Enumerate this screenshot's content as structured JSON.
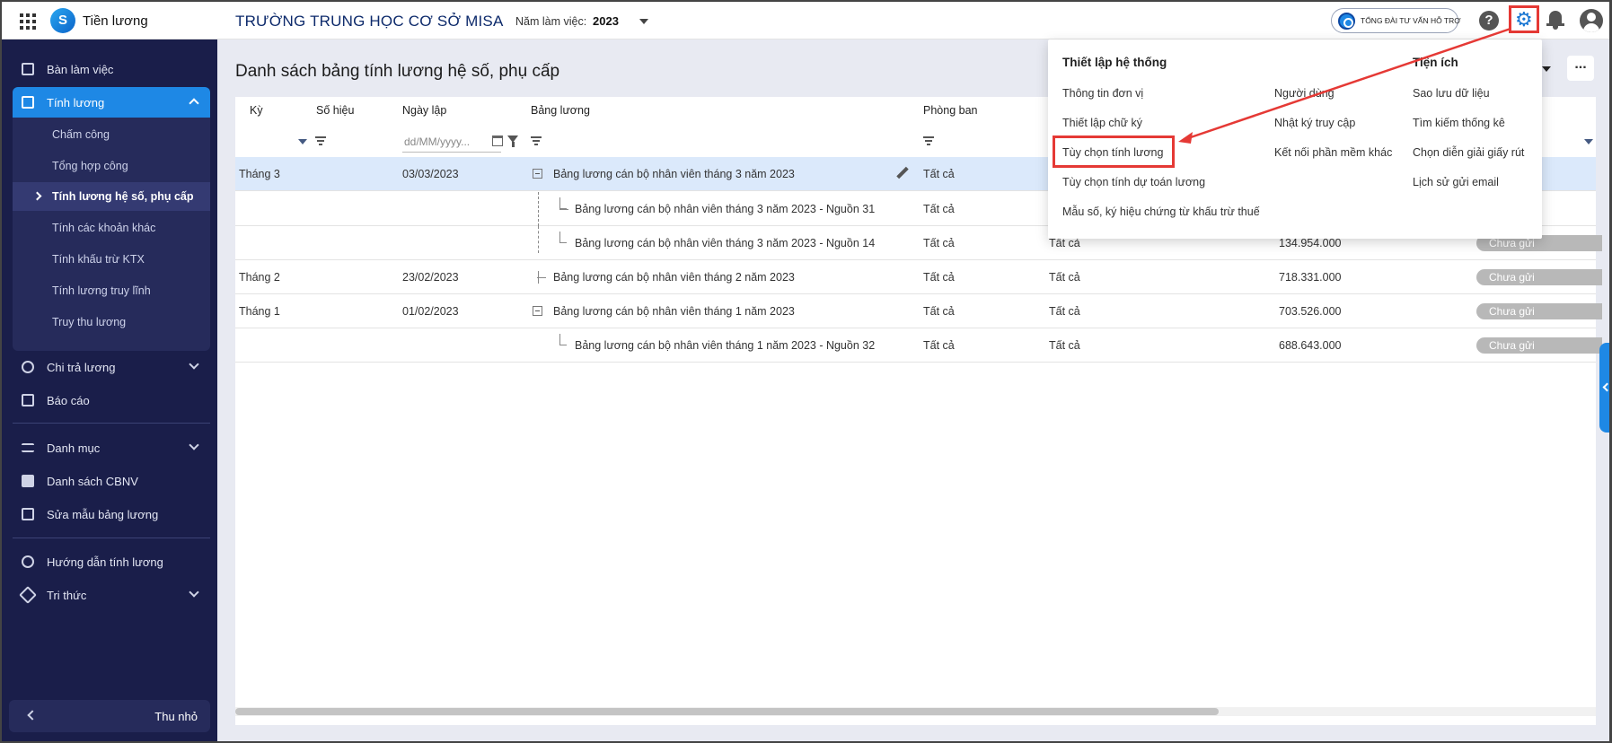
{
  "topbar": {
    "app_name": "Tiền lương",
    "school": "TRƯỜNG TRUNG HỌC CƠ SỞ MISA",
    "year_label": "Năm làm việc:",
    "year_value": "2023",
    "support_text": "TỔNG ĐÀI TƯ VẤN HỖ TRỢ"
  },
  "sidebar": {
    "items": [
      {
        "label": "Bàn làm việc"
      },
      {
        "label": "Tính lương"
      },
      {
        "label": "Chi trả lương"
      },
      {
        "label": "Báo cáo"
      },
      {
        "label": "Danh mục"
      },
      {
        "label": "Danh sách CBNV"
      },
      {
        "label": "Sửa mẫu bảng lương"
      },
      {
        "label": "Hướng dẫn tính lương"
      },
      {
        "label": "Tri thức"
      }
    ],
    "sub_items": [
      {
        "label": "Chấm công"
      },
      {
        "label": "Tổng hợp công"
      },
      {
        "label": "Tính lương hệ số, phụ cấp"
      },
      {
        "label": "Tính các khoản khác"
      },
      {
        "label": "Tính khấu trừ KTX"
      },
      {
        "label": "Tính lương truy lĩnh"
      },
      {
        "label": "Truy thu lương"
      }
    ],
    "collapse_label": "Thu nhỏ"
  },
  "main": {
    "title": "Danh sách bảng tính lương hệ số, phụ cấp",
    "columns": {
      "ky": "Kỳ",
      "so_hieu": "Số hiệu",
      "ngay_lap": "Ngày lập",
      "bang_luong": "Bảng lương",
      "phong_ban": "Phòng ban"
    },
    "date_placeholder": "dd/MM/yyyy...",
    "rows": [
      {
        "ky": "Tháng 3",
        "ngay": "03/03/2023",
        "bang": "Bảng lương cán bộ nhân viên tháng 3 năm 2023",
        "pb": "Tất cả",
        "c2": "",
        "amount": "",
        "status": ""
      },
      {
        "ky": "",
        "ngay": "",
        "bang": "Bảng lương cán bộ nhân viên tháng 3 năm 2023 - Nguồn 31",
        "pb": "Tất cả",
        "c2": "",
        "amount": "",
        "status": ""
      },
      {
        "ky": "",
        "ngay": "",
        "bang": "Bảng lương cán bộ nhân viên tháng 3 năm 2023 - Nguồn 14",
        "pb": "Tất cả",
        "c2": "Tất cả",
        "amount": "134.954.000",
        "status": "Chưa gửi"
      },
      {
        "ky": "Tháng 2",
        "ngay": "23/02/2023",
        "bang": "Bảng lương cán bộ nhân viên tháng 2 năm 2023",
        "pb": "Tất cả",
        "c2": "Tất cả",
        "amount": "718.331.000",
        "status": "Chưa gửi"
      },
      {
        "ky": "Tháng 1",
        "ngay": "01/02/2023",
        "bang": "Bảng lương cán bộ nhân viên tháng 1 năm 2023",
        "pb": "Tất cả",
        "c2": "Tất cả",
        "amount": "703.526.000",
        "status": "Chưa gửi"
      },
      {
        "ky": "",
        "ngay": "",
        "bang": "Bảng lương cán bộ nhân viên tháng 1 năm 2023 - Nguồn 32",
        "pb": "Tất cả",
        "c2": "Tất cả",
        "amount": "688.643.000",
        "status": "Chưa gửi"
      }
    ],
    "more_label": "..."
  },
  "menu": {
    "heading_system": "Thiết lập hệ thống",
    "heading_util": "Tiện ích",
    "col1": [
      "Thông tin đơn vị",
      "Thiết lập chữ ký",
      "Tùy chọn tính lương",
      "Tùy chọn tính dự toán lương",
      "Mẫu số, ký hiệu chứng từ khấu trừ thuế"
    ],
    "col2": [
      "Người dùng",
      "Nhật ký truy cập",
      "Kết nối phần mềm khác"
    ],
    "col3": [
      "Sao lưu dữ liệu",
      "Tìm kiếm thống kê",
      "Chọn diễn giải giấy rút",
      "Lịch sử gửi email"
    ]
  },
  "colors": {
    "sidebar_bg": "#1a1e4a",
    "accent": "#1e88e5",
    "highlight": "#e53935"
  }
}
